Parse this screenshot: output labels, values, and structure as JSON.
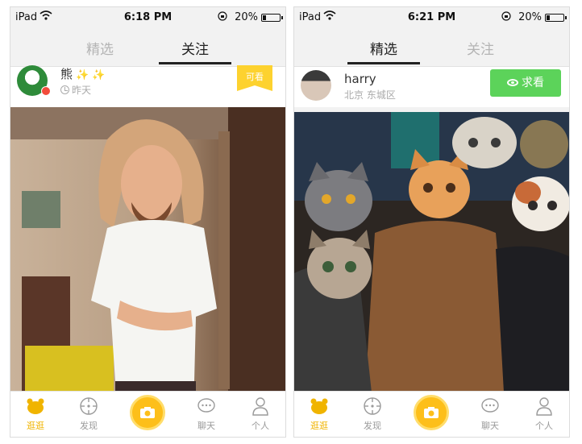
{
  "left": {
    "status": {
      "carrier": "iPad",
      "time": "6:18 PM",
      "battery": "20%"
    },
    "tabs": [
      {
        "label": "精选",
        "active": false
      },
      {
        "label": "关注",
        "active": true
      }
    ],
    "post": {
      "username": "熊",
      "sparkle": "✨ ✨",
      "time": "昨天",
      "ribbon": "可看"
    },
    "nav": [
      {
        "label": "逛逛",
        "icon": "bear-icon",
        "active": true
      },
      {
        "label": "发现",
        "icon": "compass-icon",
        "active": false
      },
      {
        "label": "聊天",
        "icon": "chat-bubble-icon",
        "active": false
      },
      {
        "label": "个人",
        "icon": "person-icon",
        "active": false
      }
    ]
  },
  "right": {
    "status": {
      "carrier": "iPad",
      "time": "6:21 PM",
      "battery": "20%"
    },
    "tabs": [
      {
        "label": "精选",
        "active": true
      },
      {
        "label": "关注",
        "active": false
      }
    ],
    "post": {
      "username": "harry",
      "location": "北京 东城区",
      "request_label": "求看"
    },
    "nav": [
      {
        "label": "逛逛",
        "icon": "bear-icon",
        "active": true
      },
      {
        "label": "发现",
        "icon": "compass-icon",
        "active": false
      },
      {
        "label": "聊天",
        "icon": "chat-bubble-icon",
        "active": false
      },
      {
        "label": "个人",
        "icon": "person-icon",
        "active": false
      }
    ]
  },
  "colors": {
    "accent": "#fdbf1a",
    "active_nav": "#f0b400",
    "request_green": "#5cd35a",
    "ribbon": "#fdd22f"
  }
}
